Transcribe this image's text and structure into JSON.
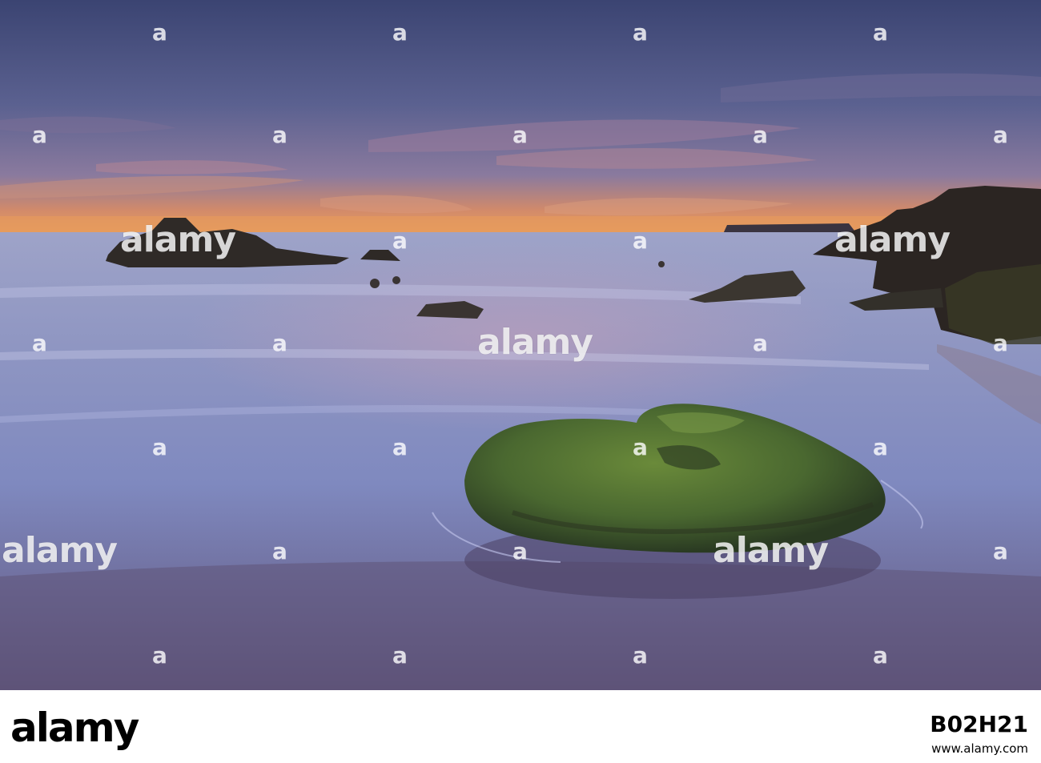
{
  "photo": {
    "subject": "seascape-at-dusk",
    "palette": {
      "sky_top": "#3f4a78",
      "sky_mid": "#6a6f9a",
      "horizon_glow": "#e69a5c",
      "sea": "#8f97c4",
      "foreground_sand": "#6b5f84",
      "rock_dark": "#2c2724",
      "moss": "#4e6a2f"
    }
  },
  "watermark": {
    "brand": "alamy",
    "letter": "a"
  },
  "footer": {
    "logo": "alamy",
    "stock_id": "B02H21",
    "url": "www.alamy.com"
  }
}
